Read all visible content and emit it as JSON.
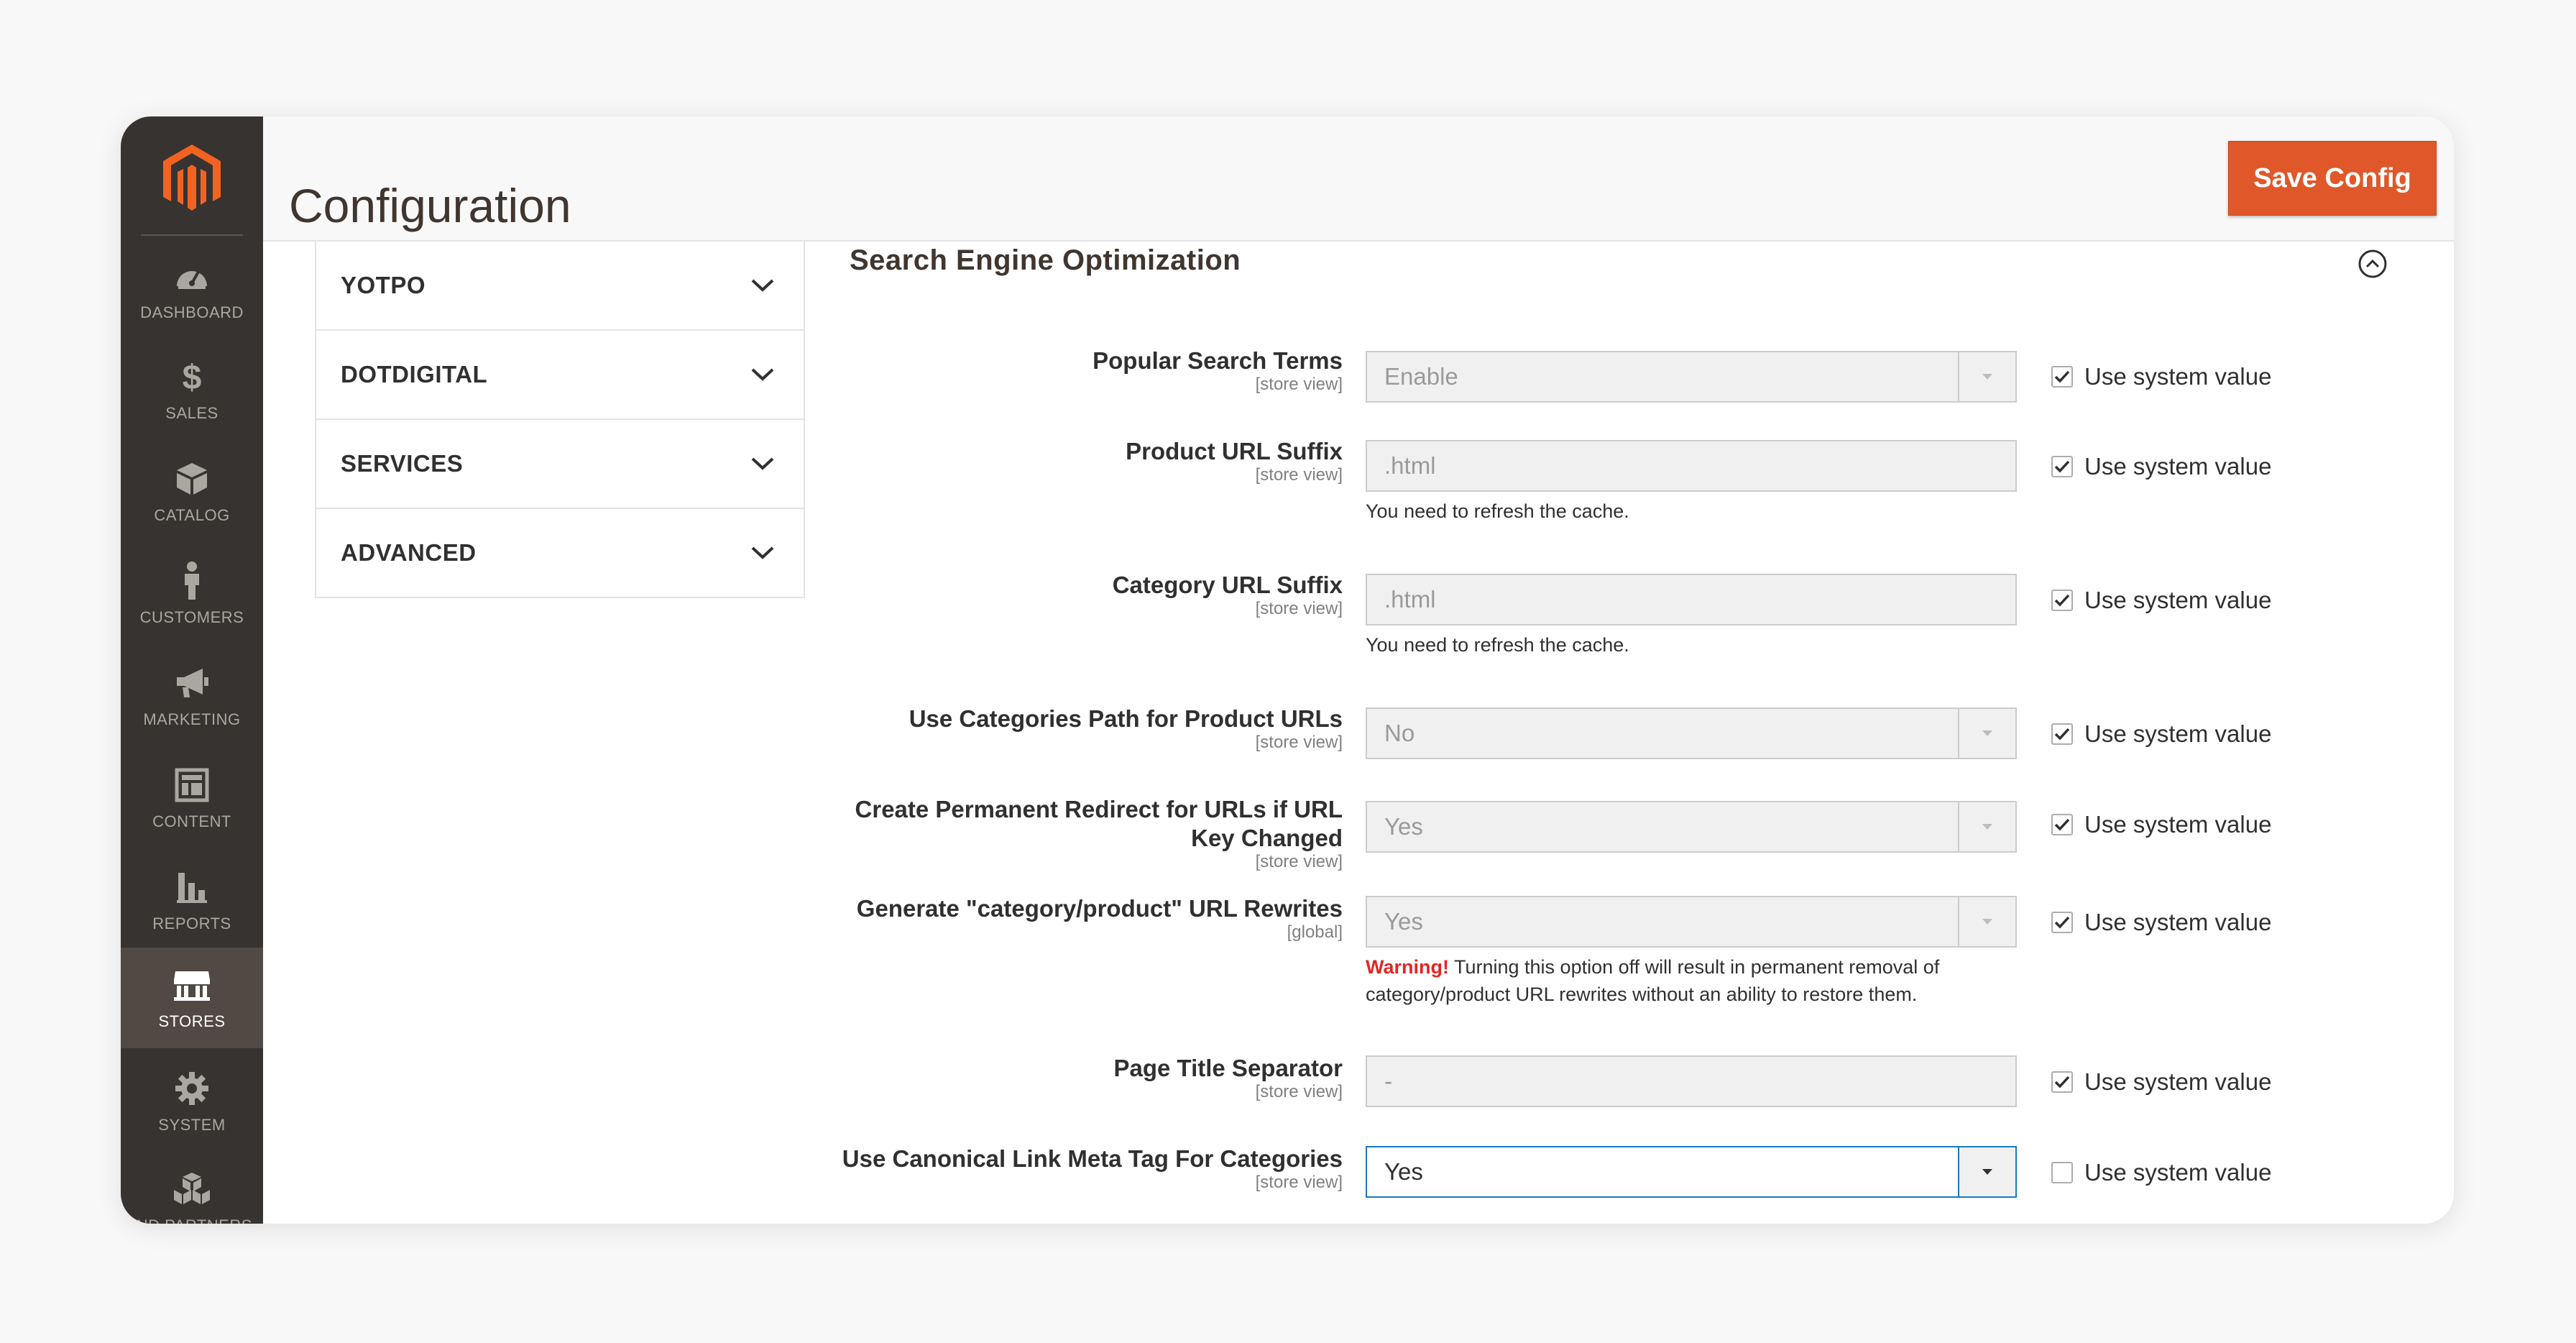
{
  "header": {
    "title": "Configuration",
    "save_label": "Save Config"
  },
  "sidebar": {
    "items": [
      {
        "label": "DASHBOARD",
        "icon": "dashboard-icon"
      },
      {
        "label": "SALES",
        "icon": "dollar-icon"
      },
      {
        "label": "CATALOG",
        "icon": "box-icon"
      },
      {
        "label": "CUSTOMERS",
        "icon": "person-icon"
      },
      {
        "label": "MARKETING",
        "icon": "megaphone-icon"
      },
      {
        "label": "CONTENT",
        "icon": "layout-icon"
      },
      {
        "label": "REPORTS",
        "icon": "bar-chart-icon"
      },
      {
        "label": "STORES",
        "icon": "storefront-icon",
        "active": true
      },
      {
        "label": "SYSTEM",
        "icon": "gear-icon"
      },
      {
        "label": "IND PARTNERS",
        "icon": "cubes-icon"
      }
    ]
  },
  "tabs": [
    {
      "label": "YOTPO"
    },
    {
      "label": "DOTDIGITAL"
    },
    {
      "label": "SERVICES"
    },
    {
      "label": "ADVANCED"
    }
  ],
  "section": {
    "title": "Search Engine Optimization"
  },
  "rows": [
    {
      "label": "Popular Search Terms",
      "scope": "[store view]",
      "value": "Enable",
      "type": "select",
      "use_system": true,
      "system_label": "Use system value"
    },
    {
      "label": "Product URL Suffix",
      "scope": "[store view]",
      "value": ".html",
      "type": "text",
      "note": "You need to refresh the cache.",
      "use_system": true,
      "system_label": "Use system value"
    },
    {
      "label": "Category URL Suffix",
      "scope": "[store view]",
      "value": ".html",
      "type": "text",
      "note": "You need to refresh the cache.",
      "use_system": true,
      "system_label": "Use system value"
    },
    {
      "label": "Use Categories Path for Product URLs",
      "scope": "[store view]",
      "value": "No",
      "type": "select",
      "use_system": true,
      "system_label": "Use system value"
    },
    {
      "label_line1": "Create Permanent Redirect for URLs if URL",
      "label_line2": "Key Changed",
      "scope": "[store view]",
      "value": "Yes",
      "type": "select",
      "use_system": true,
      "system_label": "Use system value"
    },
    {
      "label": "Generate \"category/product\" URL Rewrites",
      "scope": "[global]",
      "value": "Yes",
      "type": "select",
      "warning_label": "Warning!",
      "warning_text": " Turning this option off will result in permanent removal of",
      "warning_text2": "category/product URL rewrites without an ability to restore them.",
      "use_system": true,
      "system_label": "Use system value"
    },
    {
      "label": "Page Title Separator",
      "scope": "[store view]",
      "value": "-",
      "type": "text",
      "use_system": true,
      "system_label": "Use system value"
    },
    {
      "label": "Use Canonical Link Meta Tag For Categories",
      "scope": "[store view]",
      "value": "Yes",
      "type": "select",
      "active": true,
      "use_system": false,
      "system_label": "Use system value"
    }
  ],
  "colors": {
    "sidebar": "#373330",
    "sidebar_active": "#514943",
    "accent": "#e0582a",
    "warning": "#e22626",
    "focus": "#1979c3"
  }
}
